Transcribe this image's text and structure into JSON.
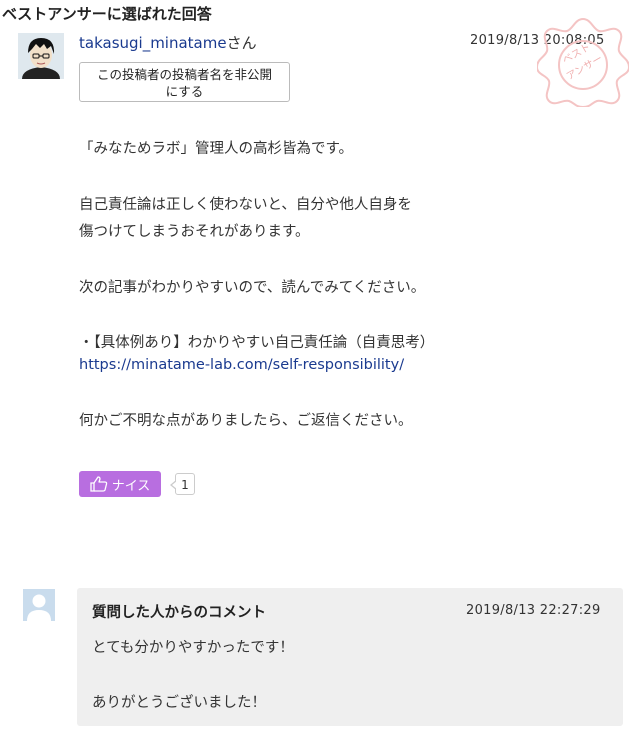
{
  "heading": "ベストアンサーに選ばれた回答",
  "answer": {
    "username": "takasugi_minatame",
    "honorific": "さん",
    "date": "2019/8/13  20:08:05",
    "hide_button_line1": "この投稿者の投稿者名を非公開",
    "hide_button_line2": "にする",
    "seal_text": "ベストアンサー",
    "body": {
      "line1": "「みなためラボ」管理人の高杉皆為です。",
      "line2": "自己責任論は正しく使わないと、自分や他人自身を",
      "line3": "傷つけてしまうおそれがあります。",
      "line4": "次の記事がわかりやすいので、読んでみてください。",
      "line5": "・【具体例あり】わかりやすい自己責任論（自責思考）",
      "link": "https://minatame-lab.com/self-responsibility/",
      "line6": "何かご不明な点がありましたら、ご返信ください。"
    },
    "nice_label": "ナイス",
    "nice_count": "1"
  },
  "comment": {
    "title": "質問した人からのコメント",
    "date": "2019/8/13 22:27:29",
    "line1": "とても分かりやすかったです！",
    "line2": "ありがとうございました！"
  },
  "colors": {
    "link": "#1a3a8f",
    "nice_button": "#b86ee0",
    "comment_bg": "#efefef",
    "seal": "#f4c4c4"
  }
}
